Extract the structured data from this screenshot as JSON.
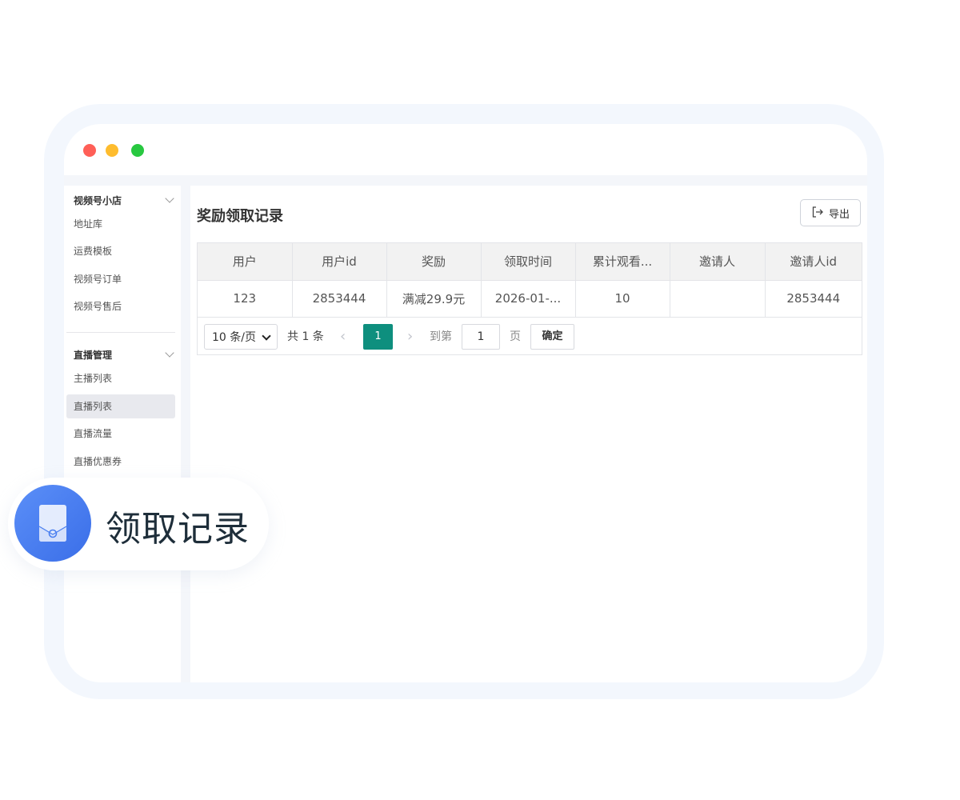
{
  "window": {
    "controls": [
      "close",
      "minimize",
      "maximize"
    ]
  },
  "sidebar": {
    "groups": [
      {
        "title": "视频号小店",
        "items": [
          "地址库",
          "运费模板",
          "视频号订单",
          "视频号售后"
        ]
      },
      {
        "title": "直播管理",
        "items": [
          "主播列表",
          "直播列表",
          "直播流量",
          "直播优惠券"
        ],
        "active_index": 1
      }
    ]
  },
  "main": {
    "title": "奖励领取记录",
    "export_label": "导出",
    "table": {
      "columns": [
        "用户",
        "用户id",
        "奖励",
        "领取时间",
        "累计观看...",
        "邀请人",
        "邀请人id"
      ],
      "rows": [
        [
          "123",
          "2853444",
          "满减29.9元",
          "2026-01-...",
          "10",
          "",
          "2853444"
        ]
      ]
    },
    "pagination": {
      "page_size": "10 条/页",
      "total": "共 1 条",
      "current_page": "1",
      "goto_label": "到第",
      "goto_value": "1",
      "page_unit": "页",
      "confirm_label": "确定"
    }
  },
  "badge": {
    "label": "领取记录",
    "icon": "envelope-icon"
  },
  "colors": {
    "accent": "#0e8f7e",
    "badge_blue": "#4a7ff0",
    "close": "#ff5f57",
    "minimize": "#febc2e",
    "maximize": "#28c840"
  }
}
